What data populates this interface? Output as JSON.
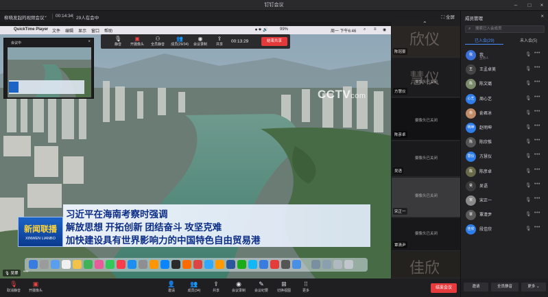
{
  "window": {
    "title": "钉钉会议"
  },
  "info": {
    "meeting_name": "柳晓发起的视频会议",
    "duration": "00:14:34",
    "participants": "29人在会中",
    "fullscreen": "全屏"
  },
  "macbar": {
    "app": "QuickTime Player",
    "menus": [
      "文件",
      "编辑",
      "显示",
      "窗口",
      "帮助"
    ],
    "battery": "99%",
    "clock": "周一 下午6:46"
  },
  "sharebar": {
    "items": [
      "静音",
      "开摄像头",
      "全员静音",
      "成员(29/34)",
      "会议录制",
      "共享"
    ],
    "timer": "00:13:29",
    "end_share": "结束共享"
  },
  "thumbnail": {
    "title": "会议中"
  },
  "news": {
    "lines": [
      "习近平在海南考察时强调",
      "解放思想 开拓创新 团结奋斗 攻坚克难",
      "加快建设具有世界影响力的中国特色自由贸易港"
    ],
    "logo_zh": "新闻联播",
    "logo_en": "XINWEN LIANBO",
    "watermark": "CCTV",
    "watermark_suffix": "com"
  },
  "tiles": [
    {
      "name": "陈冠豪",
      "big": "欣仪",
      "camera_off": ""
    },
    {
      "name": "方慧仪",
      "big": "慧仪",
      "camera_off": "摄像头已关闭"
    },
    {
      "name": "陈彦卓",
      "big": "",
      "camera_off": "摄像头已关闭"
    },
    {
      "name": "吴语",
      "big": "",
      "camera_off": "摄像头已关闭"
    },
    {
      "name": "宋正一",
      "big": "",
      "camera_off": "摄像头已关闭"
    },
    {
      "name": "覃清尹",
      "big": "",
      "camera_off": "摄像头已关闭"
    },
    {
      "name": "",
      "big": "佳欣",
      "camera_off": ""
    }
  ],
  "panel": {
    "title": "成员管理",
    "search_placeholder": "搜索已入会成员",
    "tabs": [
      "已入会(29)",
      "未入会(5)"
    ],
    "members": [
      {
        "name": "我",
        "role": "主持人",
        "color": "#3d6fd8",
        "initial": "我"
      },
      {
        "name": "王孟卓美",
        "role": "",
        "color": "#444",
        "initial": "王"
      },
      {
        "name": "陈文璐",
        "role": "",
        "color": "#7a8a6a",
        "initial": "陈"
      },
      {
        "name": "周心艺",
        "role": "",
        "color": "#2f7de8",
        "initial": "心艺"
      },
      {
        "name": "俞君冰",
        "role": "",
        "color": "#c28c68",
        "initial": "俞"
      },
      {
        "name": "赵明坤",
        "role": "",
        "color": "#2f7de8",
        "initial": "明坤"
      },
      {
        "name": "陈欣惟",
        "role": "",
        "color": "#555",
        "initial": "陈"
      },
      {
        "name": "方慧仪",
        "role": "",
        "color": "#2f7de8",
        "initial": "慧仪"
      },
      {
        "name": "陈彦卓",
        "role": "",
        "color": "#6a6a4a",
        "initial": "陈"
      },
      {
        "name": "吴语",
        "role": "",
        "color": "#3a3a3a",
        "initial": "吴"
      },
      {
        "name": "宋正一",
        "role": "",
        "color": "#8a8a8a",
        "initial": "宋"
      },
      {
        "name": "覃清尹",
        "role": "",
        "color": "#5a5a5a",
        "initial": "覃"
      },
      {
        "name": "段佳欣",
        "role": "",
        "color": "#2f7de8",
        "initial": "佳欣"
      }
    ],
    "buttons": [
      "邀请",
      "全员静音",
      "更多"
    ]
  },
  "self_tag": "吴翠",
  "toolbar": {
    "left": [
      "取消静音",
      "开摄像头"
    ],
    "center": [
      "邀请",
      "成员(34)",
      "共享",
      "会议录制",
      "会议纪要",
      "切换视图",
      "更多"
    ],
    "end": "结束会议"
  }
}
